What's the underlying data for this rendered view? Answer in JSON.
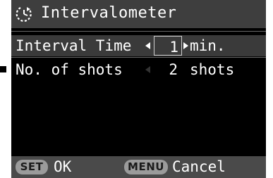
{
  "header": {
    "title": "Intervalometer",
    "icon": "intervalometer-timer-icon"
  },
  "settings": [
    {
      "label": "Interval Time",
      "value": "1",
      "unit": "min.",
      "selected": true
    },
    {
      "label": "No. of shots",
      "value": "2",
      "unit": "shots",
      "selected": false
    }
  ],
  "footer": {
    "set_key": "SET",
    "set_label": "OK",
    "menu_key": "MENU",
    "menu_label": "Cancel"
  },
  "colors": {
    "screen_bg": "#000000",
    "header_bg": "#3e3e3e",
    "selected_row_bg": "#3a3a3a",
    "footer_bg": "#4a4a4a",
    "key_bg": "#9b9b9b",
    "text": "#ffffff"
  }
}
